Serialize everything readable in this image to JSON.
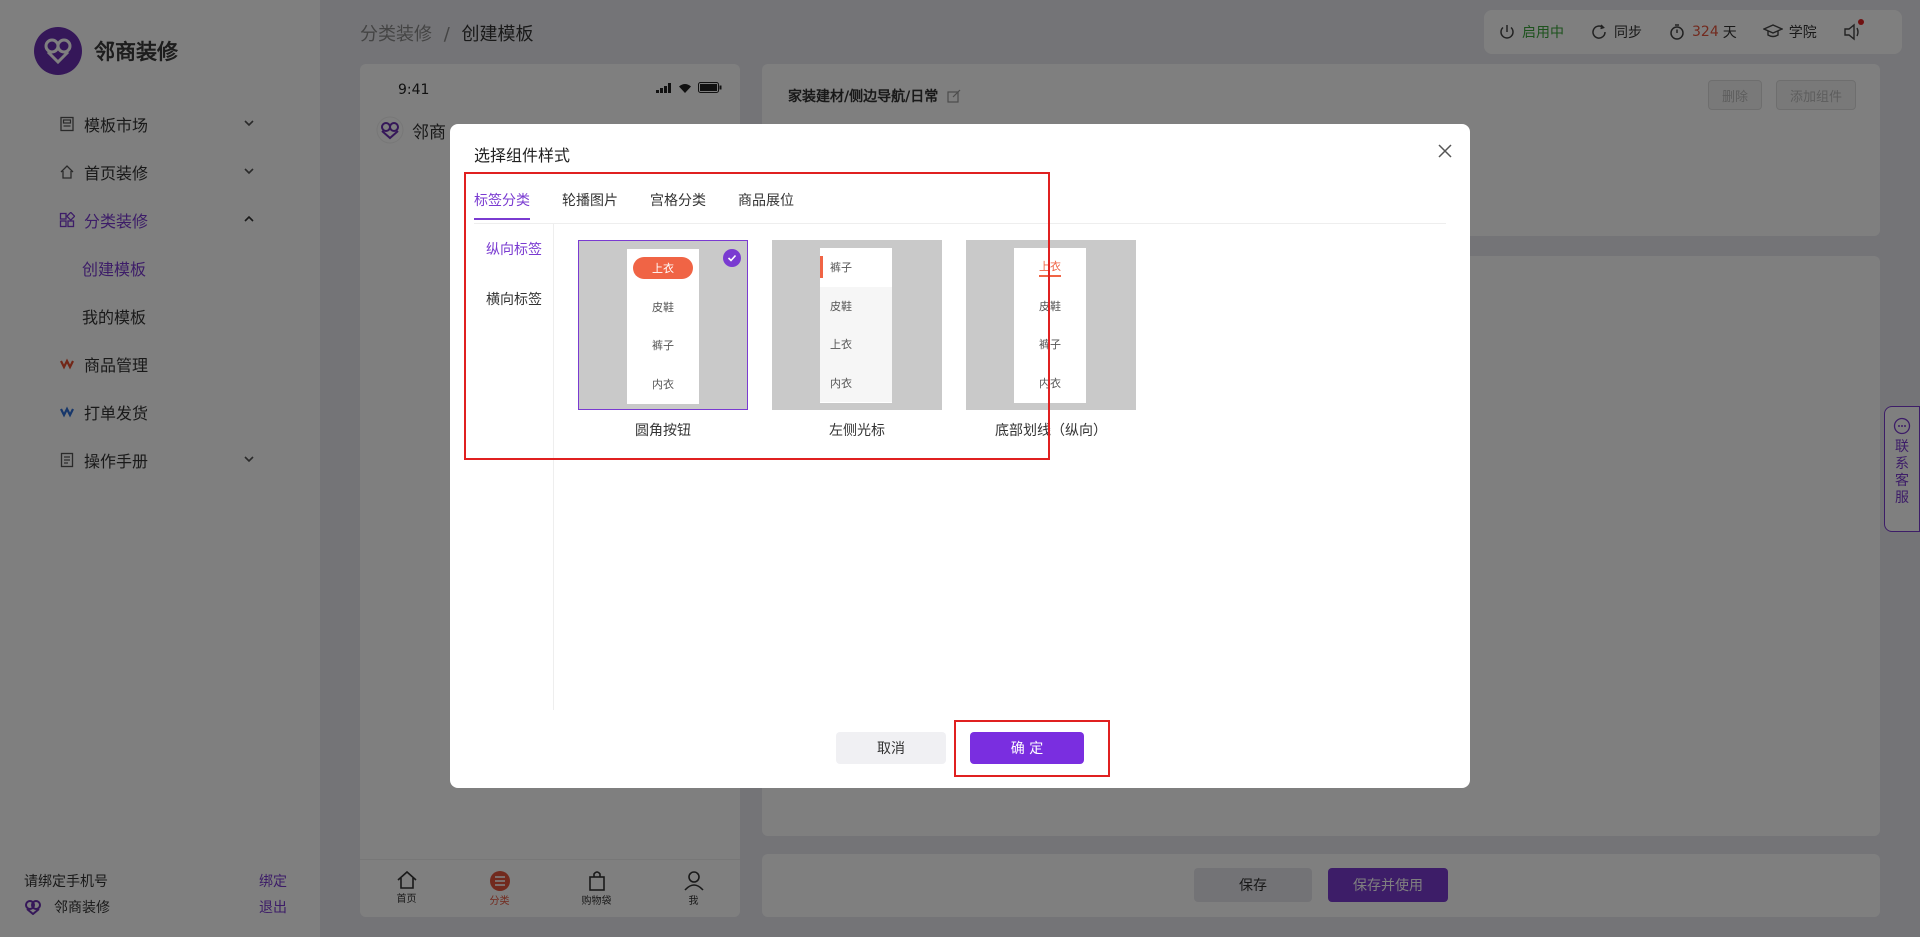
{
  "brand": {
    "name": "邻商装修",
    "color": "#6b2fb3"
  },
  "accent": "#7a3bd1",
  "sidebar": {
    "items": [
      {
        "label": "模板市场",
        "icon": "template-icon"
      },
      {
        "label": "首页装修",
        "icon": "home-icon"
      },
      {
        "label": "分类装修",
        "icon": "category-icon",
        "expanded": true
      },
      {
        "label": "商品管理",
        "icon": "goods-icon"
      },
      {
        "label": "打单发货",
        "icon": "ship-icon"
      },
      {
        "label": "操作手册",
        "icon": "manual-icon"
      }
    ],
    "sub_items": [
      {
        "label": "创建模板",
        "active": true
      },
      {
        "label": "我的模板"
      }
    ],
    "footer": {
      "bind_phone": "请绑定手机号",
      "bind_link": "绑定",
      "user_name": "邻商装修",
      "logout_link": "退出"
    }
  },
  "breadcrumb": {
    "parent": "分类装修",
    "separator": "/",
    "current": "创建模板"
  },
  "topbar": {
    "status": "启用中",
    "sync": "同步",
    "days": "324",
    "days_unit": "天",
    "academy": "学院"
  },
  "phone": {
    "time": "9:41",
    "brand": "邻商",
    "tabs": [
      "首页",
      "分类",
      "购物袋",
      "我"
    ]
  },
  "editor": {
    "path": "家装建材/侧边导航/日常",
    "delete_label": "删除",
    "add_label": "添加组件",
    "save_label": "保存",
    "save_use_label": "保存并使用"
  },
  "service_float": "联系客服",
  "dialog": {
    "title": "选择组件样式",
    "tabs": [
      "标签分类",
      "轮播图片",
      "宫格分类",
      "商品展位"
    ],
    "side_tabs": [
      "纵向标签",
      "横向标签"
    ],
    "styles": [
      {
        "caption": "圆角按钮",
        "items": [
          "上衣",
          "皮鞋",
          "裤子",
          "内衣"
        ],
        "selected": true
      },
      {
        "caption": "左侧光标",
        "items": [
          "裤子",
          "皮鞋",
          "上衣",
          "内衣"
        ]
      },
      {
        "caption": "底部划线（纵向）",
        "items": [
          "上衣",
          "皮鞋",
          "裤子",
          "内衣"
        ]
      }
    ],
    "cancel_label": "取消",
    "confirm_label": "确 定"
  }
}
